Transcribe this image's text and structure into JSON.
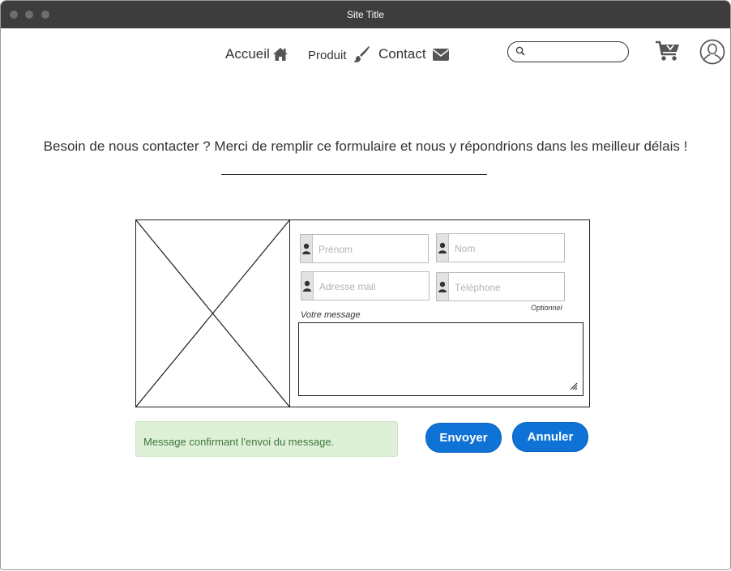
{
  "window": {
    "title": "Site Title"
  },
  "nav": {
    "home_label": "Accueil",
    "product_label": "Produit",
    "contact_label": "Contact",
    "icons": [
      "home-icon",
      "brush-icon",
      "envelope-icon",
      "search-icon",
      "cart-icon",
      "user-icon"
    ]
  },
  "search": {
    "placeholder": ""
  },
  "intro": {
    "text": "Besoin de nous contacter ? Merci de remplir ce formulaire et nous y répondrions dans les meilleur délais !"
  },
  "form": {
    "first_name_placeholder": "Prénom",
    "last_name_placeholder": "Nom",
    "email_placeholder": "Adresse mail",
    "phone_placeholder": "Téléphone",
    "phone_note": "Optionnel",
    "message_label": "Votre message",
    "message_value": ""
  },
  "alert": {
    "text": "Message confirmant l'envoi du message."
  },
  "buttons": {
    "send_label": "Envoyer",
    "cancel_label": "Annuler"
  },
  "colors": {
    "primary": "#0e72d6",
    "alert_bg": "#dff0d8",
    "alert_text": "#3c763d",
    "titlebar": "#3d3d3d"
  }
}
